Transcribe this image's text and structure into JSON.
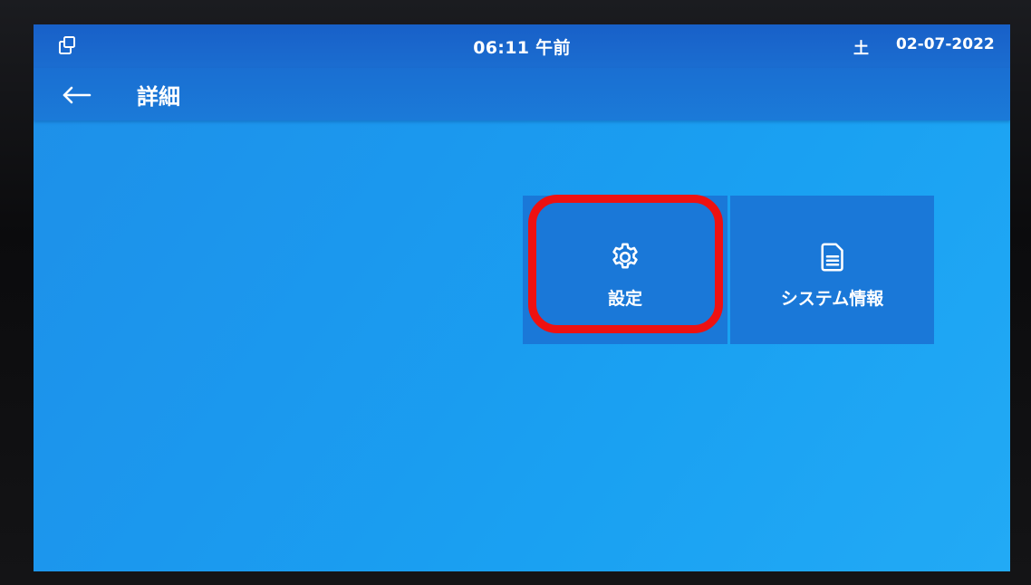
{
  "statusbar": {
    "time": "06:11 午前",
    "day": "土",
    "date": "02-07-2022",
    "left_icon": "multi-window-icon"
  },
  "titlebar": {
    "back_icon": "back-arrow-icon",
    "title": "詳細"
  },
  "tiles": [
    {
      "label": "設定",
      "icon": "gear-icon",
      "highlighted": true
    },
    {
      "label": "システム情報",
      "icon": "document-icon",
      "highlighted": false
    }
  ],
  "colors": {
    "statusbar_bg": "#1860c8",
    "titlebar_bg": "#1a6fd2",
    "screen_bg": "#1b98ee",
    "tile_bg": "#1a78d8",
    "highlight": "#ee1111",
    "text": "#ffffff"
  }
}
